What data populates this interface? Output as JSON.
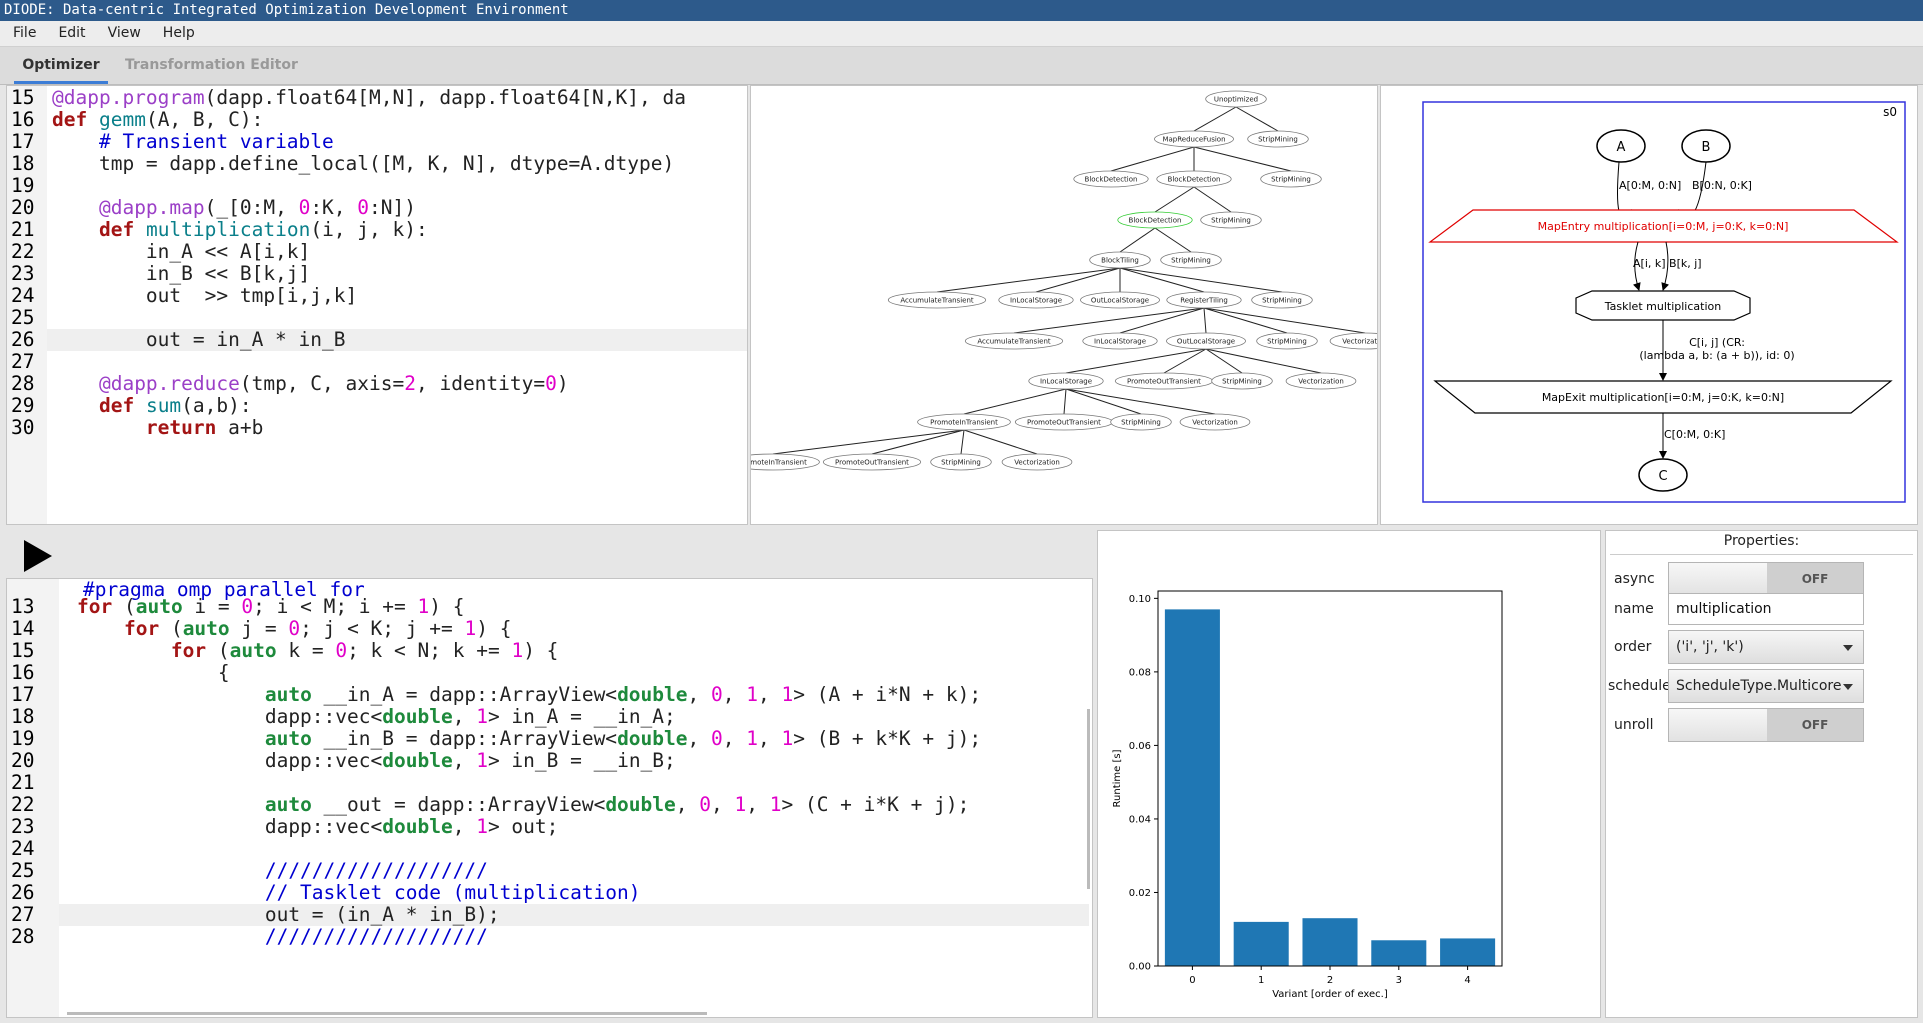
{
  "window": {
    "title": "DIODE: Data-centric Integrated Optimization Development Environment"
  },
  "menu": [
    "File",
    "Edit",
    "View",
    "Help"
  ],
  "tabs": [
    {
      "label": "Optimizer",
      "active": true
    },
    {
      "label": "Transformation Editor",
      "active": false
    }
  ],
  "python_editor": {
    "lines": [
      {
        "n": "15",
        "text": "@dapp.program(dapp.float64[M,N], dapp.float64[N,K], da"
      },
      {
        "n": "16",
        "text": "def gemm(A, B, C):"
      },
      {
        "n": "17",
        "text": "    # Transient variable"
      },
      {
        "n": "18",
        "text": "    tmp = dapp.define_local([M, K, N], dtype=A.dtype)"
      },
      {
        "n": "19",
        "text": ""
      },
      {
        "n": "20",
        "text": "    @dapp.map(_[0:M, 0:K, 0:N])"
      },
      {
        "n": "21",
        "text": "    def multiplication(i, j, k):"
      },
      {
        "n": "22",
        "text": "        in_A << A[i,k]"
      },
      {
        "n": "23",
        "text": "        in_B << B[k,j]"
      },
      {
        "n": "24",
        "text": "        out  >> tmp[i,j,k]"
      },
      {
        "n": "25",
        "text": ""
      },
      {
        "n": "26",
        "text": "        out = in_A * in_B"
      },
      {
        "n": "27",
        "text": ""
      },
      {
        "n": "28",
        "text": "    @dapp.reduce(tmp, C, axis=2, identity=0)"
      },
      {
        "n": "29",
        "text": "    def sum(a,b):"
      },
      {
        "n": "30",
        "text": "        return a+b"
      }
    ],
    "current_line": "26"
  },
  "transform_tree": {
    "nodes": [
      {
        "id": "n0",
        "label": "Unoptimized"
      },
      {
        "id": "n1",
        "label": "MapReduceFusion"
      },
      {
        "id": "n2",
        "label": "StripMining"
      },
      {
        "id": "n3",
        "label": "BlockDetection"
      },
      {
        "id": "n4",
        "label": "BlockDetection"
      },
      {
        "id": "n5",
        "label": "StripMining"
      },
      {
        "id": "n6",
        "label": "BlockDetection"
      },
      {
        "id": "n7",
        "label": "StripMining"
      },
      {
        "id": "n8",
        "label": "BlockTiling"
      },
      {
        "id": "n9",
        "label": "StripMining"
      },
      {
        "id": "n10",
        "label": "AccumulateTransient"
      },
      {
        "id": "n11",
        "label": "InLocalStorage"
      },
      {
        "id": "n12",
        "label": "OutLocalStorage"
      },
      {
        "id": "n13",
        "label": "RegisterTiling"
      },
      {
        "id": "n14",
        "label": "StripMining"
      },
      {
        "id": "n15",
        "label": "AccumulateTransient"
      },
      {
        "id": "n16",
        "label": "InLocalStorage"
      },
      {
        "id": "n17",
        "label": "OutLocalStorage"
      },
      {
        "id": "n18",
        "label": "StripMining"
      },
      {
        "id": "n19",
        "label": "Vectorization"
      },
      {
        "id": "n20",
        "label": "InLocalStorage"
      },
      {
        "id": "n21",
        "label": "PromoteOutTransient"
      },
      {
        "id": "n22",
        "label": "StripMining"
      },
      {
        "id": "n23",
        "label": "Vectorization"
      },
      {
        "id": "n24",
        "label": "PromoteInTransient"
      },
      {
        "id": "n25",
        "label": "PromoteOutTransient"
      },
      {
        "id": "n26",
        "label": "StripMining"
      },
      {
        "id": "n27",
        "label": "Vectorization"
      },
      {
        "id": "n28",
        "label": "PromoteInTransient"
      },
      {
        "id": "n29",
        "label": "PromoteOutTransient"
      },
      {
        "id": "n30",
        "label": "StripMining"
      },
      {
        "id": "n31",
        "label": "Vectorization"
      }
    ],
    "selected": "n6"
  },
  "sdfg": {
    "state_label": "s0",
    "node_a": "A",
    "node_b": "B",
    "edge_a": "A[0:M, 0:N]",
    "edge_b": "B[0:N, 0:K]",
    "map_entry": "MapEntry multiplication[i=0:M, j=0:K, k=0:N]",
    "edge_in": "A[i, k] B[k, j]",
    "tasklet": "Tasklet multiplication",
    "edge_out_1": "C[i, j] (CR:",
    "edge_out_2": "(lambda a, b: (a + b)), id: 0)",
    "map_exit": "MapExit multiplication[i=0:M, j=0:K, k=0:N]",
    "edge_c": "C[0:M, 0:K]",
    "node_c": "C"
  },
  "cpp_editor": {
    "partial_top": "#pragma omp parallel for",
    "lines": [
      {
        "n": "13",
        "text": "for (auto i = 0; i < M; i += 1) {"
      },
      {
        "n": "14",
        "text": "    for (auto j = 0; j < K; j += 1) {"
      },
      {
        "n": "15",
        "text": "        for (auto k = 0; k < N; k += 1) {"
      },
      {
        "n": "16",
        "text": "            {"
      },
      {
        "n": "17",
        "text": "                auto __in_A = dapp::ArrayView<double, 0, 1, 1> (A + i*N + k);"
      },
      {
        "n": "18",
        "text": "                dapp::vec<double, 1> in_A = __in_A;"
      },
      {
        "n": "19",
        "text": "                auto __in_B = dapp::ArrayView<double, 0, 1, 1> (B + k*K + j);"
      },
      {
        "n": "20",
        "text": "                dapp::vec<double, 1> in_B = __in_B;"
      },
      {
        "n": "21",
        "text": ""
      },
      {
        "n": "22",
        "text": "                auto __out = dapp::ArrayView<double, 0, 1, 1> (C + i*K + j);"
      },
      {
        "n": "23",
        "text": "                dapp::vec<double, 1> out;"
      },
      {
        "n": "24",
        "text": ""
      },
      {
        "n": "25",
        "text": "                ///////////////////"
      },
      {
        "n": "26",
        "text": "                // Tasklet code (multiplication)"
      },
      {
        "n": "27",
        "text": "                out = (in_A * in_B);"
      },
      {
        "n": "28",
        "text": "                ///////////////////"
      }
    ],
    "current_line": "27"
  },
  "chart_data": {
    "type": "bar",
    "categories": [
      "0",
      "1",
      "2",
      "3",
      "4"
    ],
    "values": [
      0.097,
      0.012,
      0.013,
      0.007,
      0.0075
    ],
    "ylim": [
      0,
      0.102
    ],
    "yticks": [
      "0.00",
      "0.02",
      "0.04",
      "0.06",
      "0.08",
      "0.10"
    ],
    "ytick_values": [
      0,
      0.02,
      0.04,
      0.06,
      0.08,
      0.1
    ],
    "xlabel": "Variant [order of exec.]",
    "ylabel": "Runtime [s]",
    "bar_color": "#1f77b4"
  },
  "properties": {
    "title": "Properties:",
    "async_label": "async",
    "async_value": "OFF",
    "name_label": "name",
    "name_value": "multiplication",
    "order_label": "order",
    "order_value": "('i', 'j', 'k')",
    "schedule_label": "schedule",
    "schedule_value": "ScheduleType.Multicore",
    "unroll_label": "unroll",
    "unroll_value": "OFF"
  },
  "colors": {
    "titlebar": "#2d5a8b",
    "accent": "#3c7dd6",
    "map_entry": "#e00000",
    "state_border": "#3333dd",
    "selected_node": "#33cc33"
  }
}
